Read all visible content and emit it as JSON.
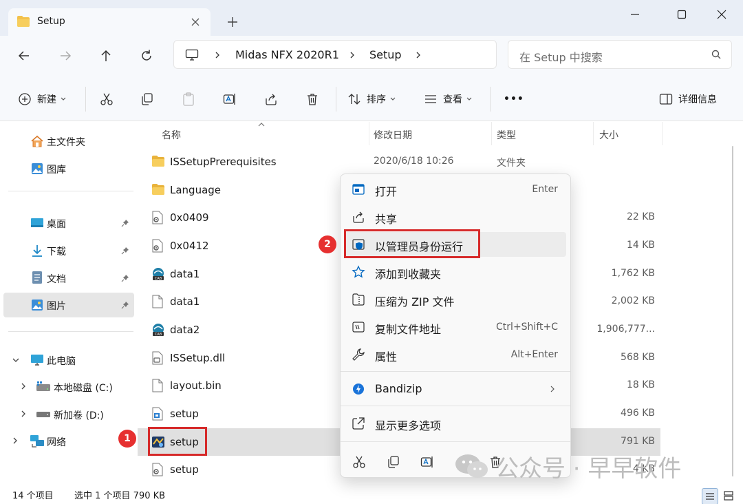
{
  "tab": {
    "title": "Setup"
  },
  "address": {
    "crumbs": [
      "Midas NFX 2020R1",
      "Setup"
    ]
  },
  "search": {
    "placeholder": "在 Setup 中搜索"
  },
  "toolbar": {
    "new_label": "新建",
    "sort_label": "排序",
    "view_label": "查看",
    "more_label": "•••",
    "details_label": "详细信息"
  },
  "sidebar": {
    "home": "主文件夹",
    "gallery": "图库",
    "desktop": "桌面",
    "downloads": "下载",
    "documents": "文档",
    "pictures": "图片",
    "this_pc": "此电脑",
    "local_disk": "本地磁盘 (C:)",
    "new_volume": "新加卷 (D:)",
    "network": "网络"
  },
  "columns": {
    "name": "名称",
    "modified": "修改日期",
    "type": "类型",
    "size": "大小"
  },
  "files": [
    {
      "name": "ISSetupPrerequisites",
      "date": "2020/6/18 10:26",
      "type": "文件夹",
      "size": "",
      "icon": "folder-icon"
    },
    {
      "name": "Language",
      "date": "",
      "type": "",
      "size": "",
      "icon": "folder-icon"
    },
    {
      "name": "0x0409",
      "date": "",
      "type": "",
      "size": "22 KB",
      "icon": "settings-file-icon"
    },
    {
      "name": "0x0412",
      "date": "",
      "type": "",
      "size": "14 KB",
      "icon": "settings-file-icon"
    },
    {
      "name": "data1",
      "date": "",
      "type": "",
      "size": "1,762 KB",
      "icon": "cab-file-icon"
    },
    {
      "name": "data1",
      "date": "",
      "type": "",
      "size": "2,002 KB",
      "icon": "file-icon"
    },
    {
      "name": "data2",
      "date": "",
      "type": "",
      "size": "1,906,777...",
      "icon": "cab-file-icon"
    },
    {
      "name": "ISSetup.dll",
      "date": "",
      "type": "",
      "size": "568 KB",
      "icon": "dll-file-icon"
    },
    {
      "name": "layout.bin",
      "date": "",
      "type": "",
      "size": "18 KB",
      "icon": "file-icon"
    },
    {
      "name": "setup",
      "date": "",
      "type": "",
      "size": "496 KB",
      "icon": "installer-icon"
    },
    {
      "name": "setup",
      "date": "",
      "type": "",
      "size": "791 KB",
      "icon": "setup-exe-icon"
    },
    {
      "name": "setup",
      "date": "",
      "type": "",
      "size": "4 KB",
      "icon": "settings-file-icon"
    }
  ],
  "context_menu": {
    "open": "打开",
    "open_key": "Enter",
    "share": "共享",
    "run_as_admin": "以管理员身份运行",
    "add_favorites": "添加到收藏夹",
    "compress_zip": "压缩为 ZIP 文件",
    "copy_path": "复制文件地址",
    "copy_path_key": "Ctrl+Shift+C",
    "properties": "属性",
    "properties_key": "Alt+Enter",
    "bandizip": "Bandizip",
    "more_options": "显示更多选项"
  },
  "status": {
    "count": "14 个项目",
    "selection": "选中 1 个项目  790 KB"
  },
  "annotations": {
    "badge1": "1",
    "badge2": "2"
  },
  "watermark": "公众号 · 早早软件",
  "colors": {
    "accent": "#0067c0",
    "folder": "#f3c14b",
    "highlight": "#d62a2a"
  }
}
